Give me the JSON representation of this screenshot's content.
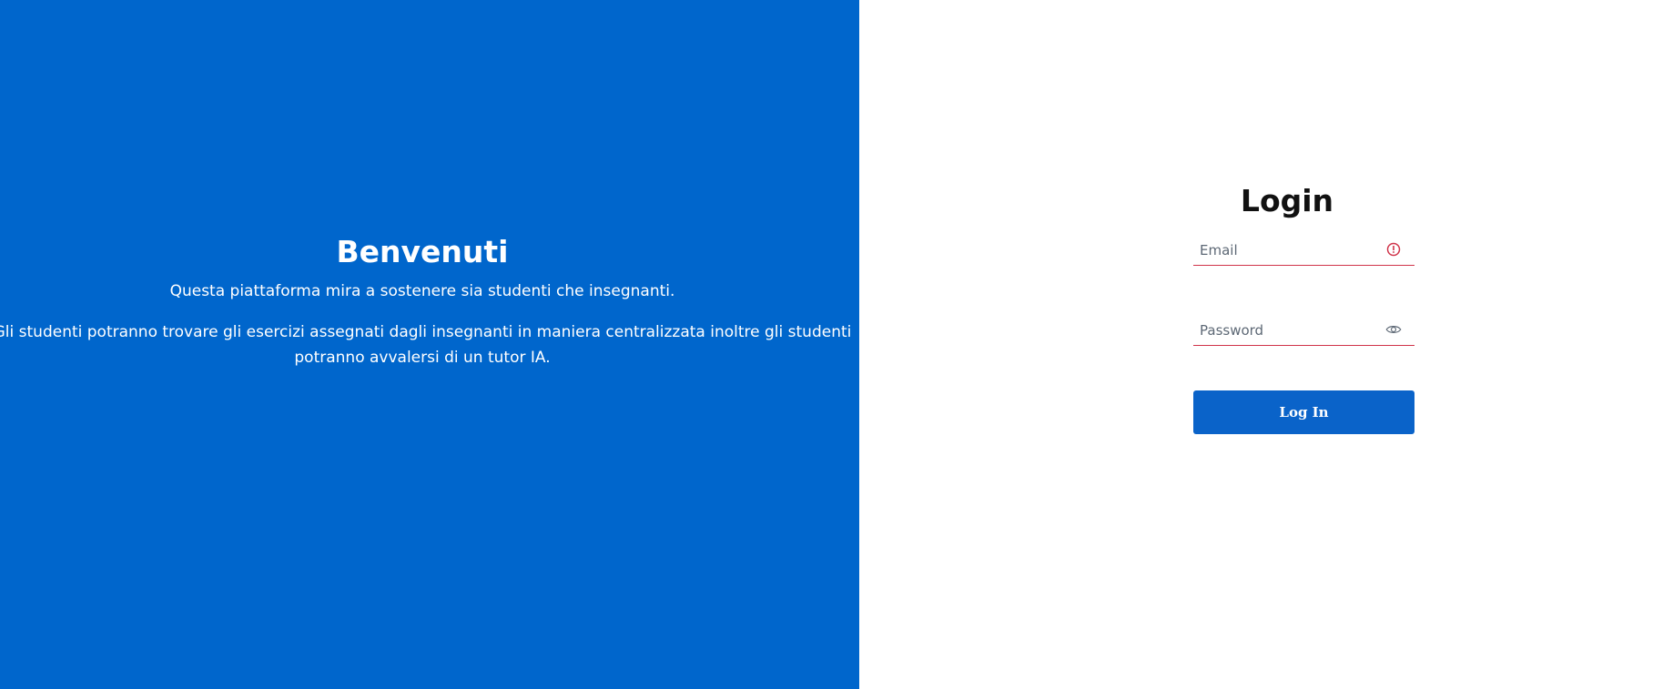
{
  "colors": {
    "hero_background": "#0066cc",
    "button_background": "#0a63c9",
    "error_accent": "#d0344a"
  },
  "hero": {
    "title": "Benvenuti",
    "subtitle": "Questa piattaforma mira a sostenere sia studenti che insegnanti.",
    "body": "Gli studenti potranno trovare gli esercizi assegnati dagli insegnanti in maniera centralizzata inoltre gli studenti potranno avvalersi di un tutor IA."
  },
  "login": {
    "title": "Login",
    "email": {
      "placeholder": "Email",
      "value": "",
      "icon": "error-alert-icon"
    },
    "password": {
      "placeholder": "Password",
      "value": "",
      "icon": "eye-icon"
    },
    "submit_label": "Log In"
  }
}
